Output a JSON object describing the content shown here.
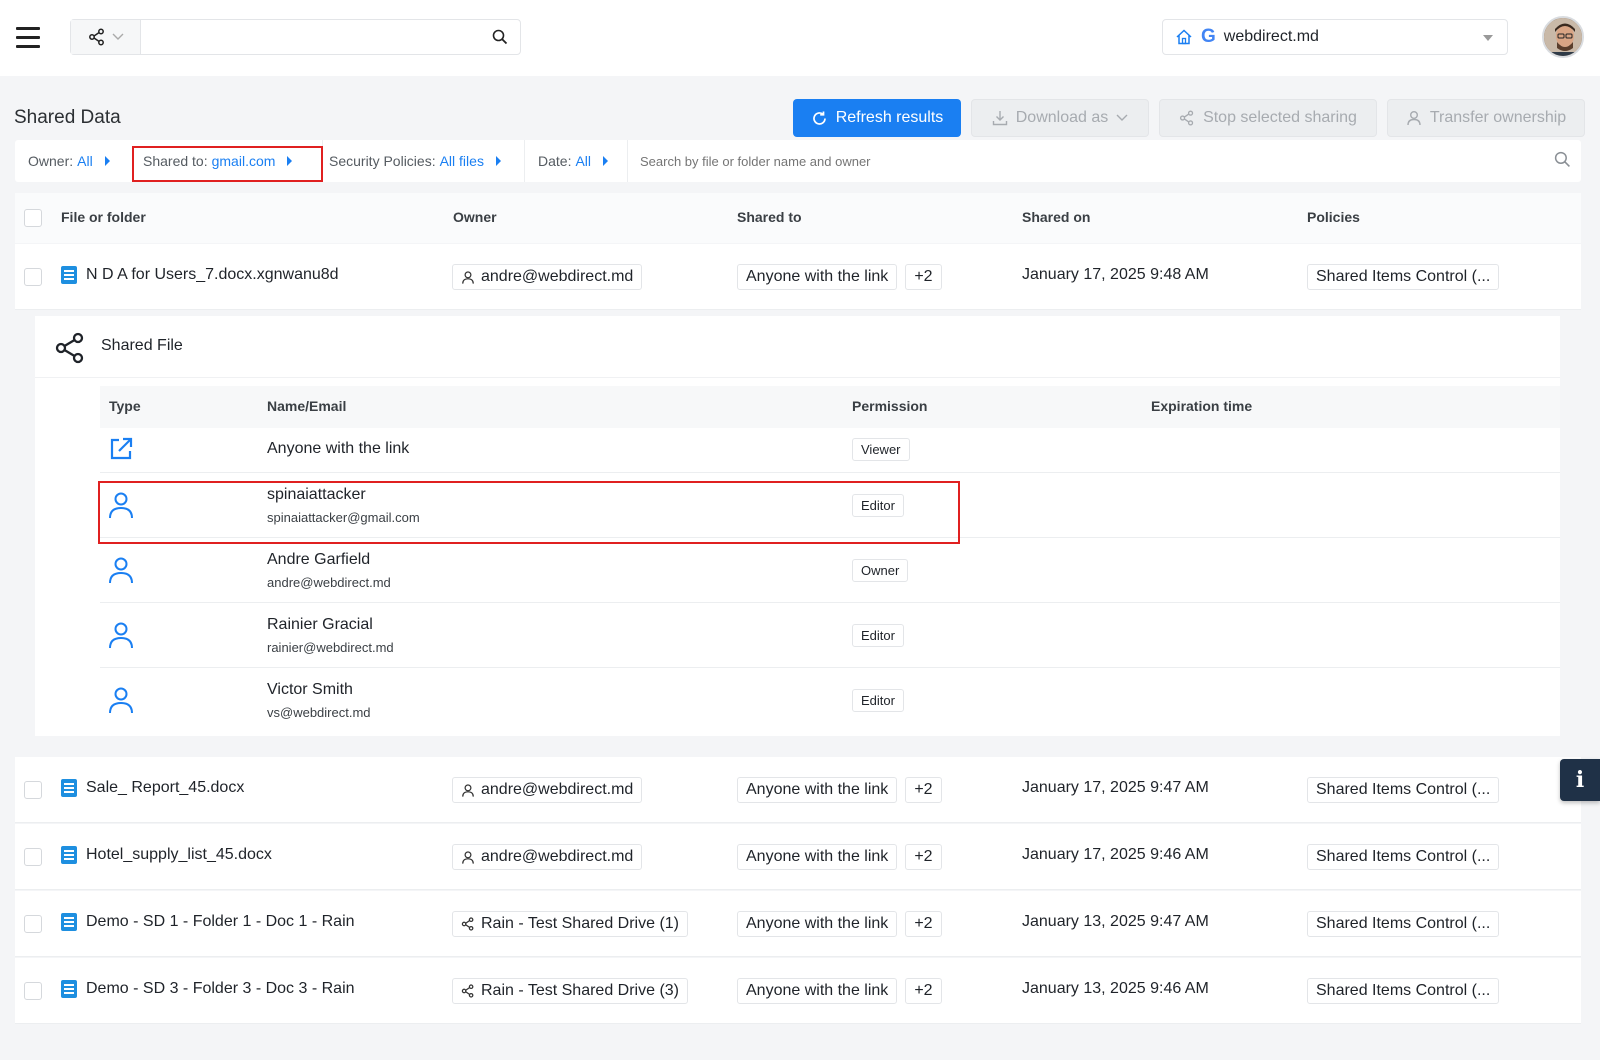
{
  "topbar": {
    "search_value": "",
    "domain": "webdirect.md"
  },
  "header": {
    "title": "Shared Data",
    "refresh_label": "Refresh results",
    "download_label": "Download as",
    "stop_label": "Stop selected sharing",
    "transfer_label": "Transfer ownership"
  },
  "filters": {
    "owner_label": "Owner:",
    "owner_value": "All",
    "shared_to_label": "Shared to:",
    "shared_to_value": "gmail.com",
    "security_label": "Security Policies:",
    "security_value": "All files",
    "date_label": "Date:",
    "date_value": "All",
    "search_placeholder": "Search by file or folder name and owner"
  },
  "columns": {
    "file": "File or folder",
    "owner": "Owner",
    "shared_to": "Shared to",
    "shared_on": "Shared on",
    "policies": "Policies"
  },
  "rows": [
    {
      "name": "N D A for Users_7.docx.xgnwanu8d",
      "owner": "andre@webdirect.md",
      "owner_type": "user",
      "shared_to": "Anyone with the link",
      "count": "+2",
      "shared_on": "January 17, 2025 9:48 AM",
      "policy": "Shared Items Control (..."
    },
    {
      "name": "Sale_ Report_45.docx",
      "owner": "andre@webdirect.md",
      "owner_type": "user",
      "shared_to": "Anyone with the link",
      "count": "+2",
      "shared_on": "January 17, 2025 9:47 AM",
      "policy": "Shared Items Control (..."
    },
    {
      "name": "Hotel_supply_list_45.docx",
      "owner": "andre@webdirect.md",
      "owner_type": "user",
      "shared_to": "Anyone with the link",
      "count": "+2",
      "shared_on": "January 17, 2025 9:46 AM",
      "policy": "Shared Items Control (..."
    },
    {
      "name": "Demo - SD 1 - Folder 1 - Doc 1 - Rain",
      "owner": "Rain - Test Shared Drive (1)",
      "owner_type": "drive",
      "shared_to": "Anyone with the link",
      "count": "+2",
      "shared_on": "January 13, 2025 9:47 AM",
      "policy": "Shared Items Control (..."
    },
    {
      "name": "Demo - SD 3 - Folder 3 - Doc 3 - Rain",
      "owner": "Rain - Test Shared Drive (3)",
      "owner_type": "drive",
      "shared_to": "Anyone with the link",
      "count": "+2",
      "shared_on": "January 13, 2025 9:46 AM",
      "policy": "Shared Items Control (..."
    }
  ],
  "panel": {
    "title": "Shared File",
    "columns": {
      "type": "Type",
      "name": "Name/Email",
      "permission": "Permission",
      "expiration": "Expiration time"
    },
    "entries": [
      {
        "type": "link",
        "name": "Anyone with the link",
        "email": "",
        "permission": "Viewer"
      },
      {
        "type": "user",
        "name": "spinaiattacker",
        "email": "spinaiattacker@gmail.com",
        "permission": "Editor"
      },
      {
        "type": "user",
        "name": "Andre Garfield",
        "email": "andre@webdirect.md",
        "permission": "Owner"
      },
      {
        "type": "user",
        "name": "Rainier Gracial",
        "email": "rainier@webdirect.md",
        "permission": "Editor"
      },
      {
        "type": "user",
        "name": "Victor Smith",
        "email": "vs@webdirect.md",
        "permission": "Editor"
      }
    ]
  },
  "info_button": "i",
  "colors": {
    "accent": "#1a7ff2",
    "highlight": "#e02020",
    "doc_icon": "#1e8fe0"
  }
}
